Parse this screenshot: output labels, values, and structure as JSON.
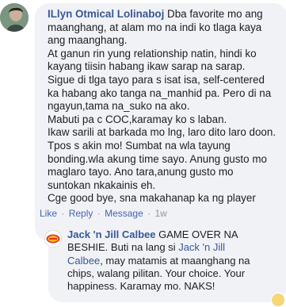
{
  "comment": {
    "author": "ILlyn Otmical Lolinaboj",
    "first_line": "Dba favorite mo ang",
    "lines": [
      "maanghang, at alam mo na indi ko tlaga kaya",
      "ang maanghang.",
      "At ganun rin yung relationship natin, hindi ko",
      "kayang tiisin habang ikaw sarap na sarap.",
      "Sigue di tlga tayo para s isat isa, self-centered",
      "ka habang ako tanga na_manhid pa. Pero di na",
      "ngayun,tama na_suko na ako.",
      "Mabuti pa c COC,karamay ko s laban.",
      "Ikaw sarili at barkada mo lng, laro dito laro doon.",
      "Tpos s akin mo! Sumbat na wla tayung",
      "bonding.wla akung time sayo. Anung gusto mo",
      "maglaro tayo. Ano tara,anung gusto mo",
      "suntokan nkakainis eh.",
      "Cge good bye, sna makahanap ka ng player"
    ],
    "actions": {
      "like": "Like",
      "reply": "Reply",
      "message": "Message",
      "time": "1w",
      "separator": "·"
    }
  },
  "reply": {
    "author": "Jack 'n Jill Calbee",
    "first_text": " GAME OVER NA",
    "line2_pre": "BESHIE. Buti na lang si ",
    "line2_link": "Jack 'n Jill",
    "line3_link": "Calbee",
    "line3_rest": ", may matamis at maanghang na",
    "line4": "chips, walang pilitan. Your choice. Your",
    "line5": "happiness. Karamay mo. NAKS!",
    "avatar_logo_text": "Jack n Jill"
  },
  "colors": {
    "link": "#385898",
    "action": "#4267b2",
    "bubble": "#f1f2f6",
    "text": "#1c1e21"
  }
}
